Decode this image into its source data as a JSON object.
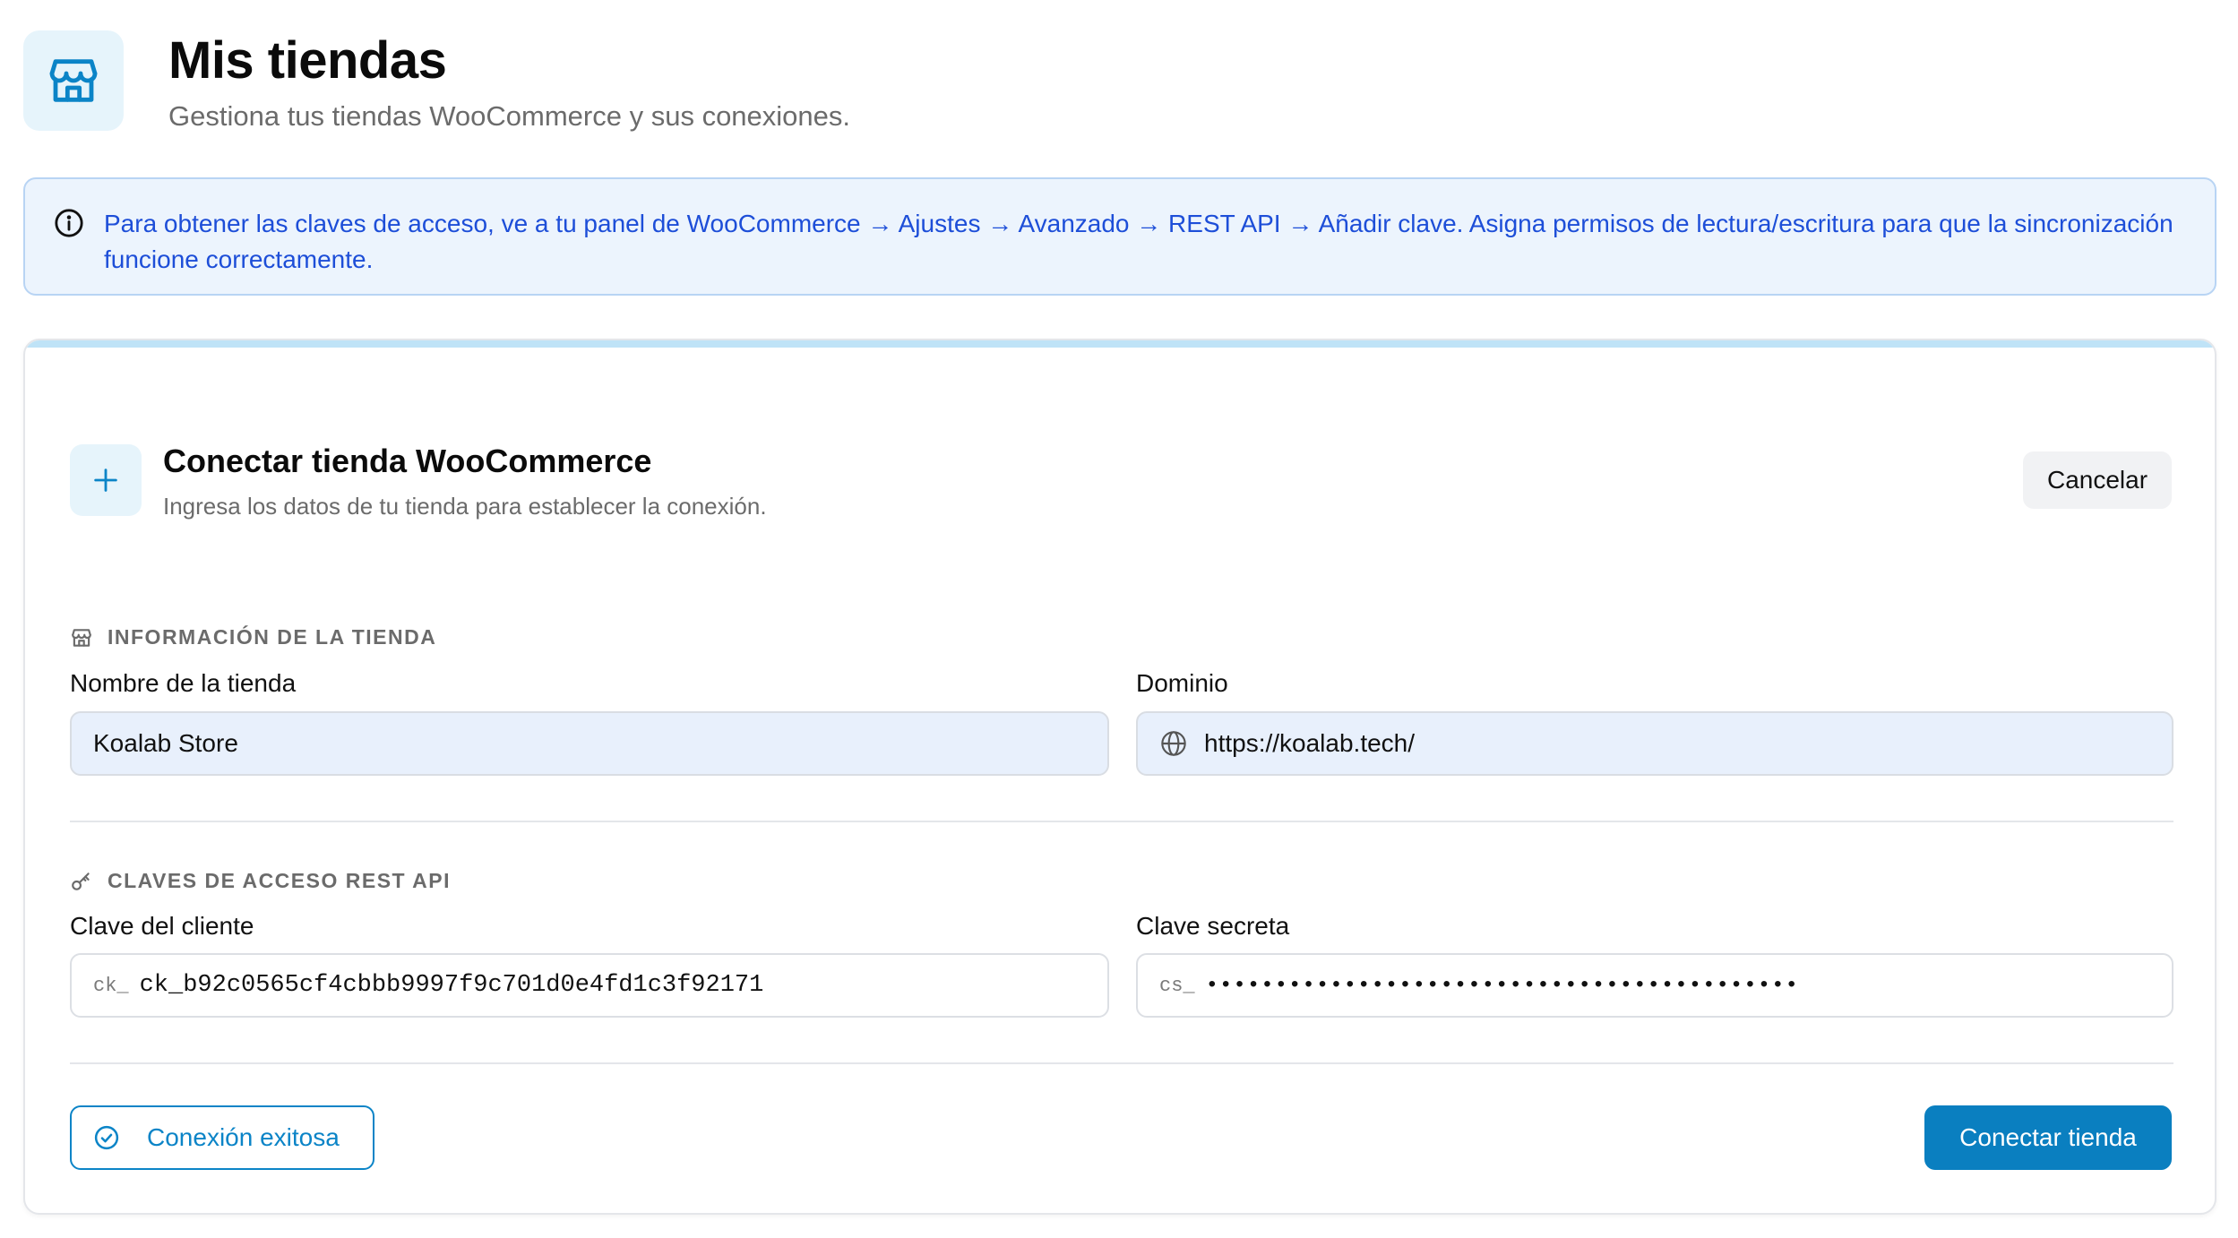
{
  "header": {
    "title": "Mis tiendas",
    "subtitle": "Gestiona tus tiendas WooCommerce y sus conexiones.",
    "icon": "store-icon"
  },
  "info_banner": {
    "icon": "info-icon",
    "text": "Para obtener las claves de acceso, ve a tu panel de WooCommerce → Ajustes → Avanzado → REST API → Añadir clave. Asigna permisos de lectura/escritura para que la sincronización funcione correctamente."
  },
  "connect_form": {
    "title": "Conectar tienda WooCommerce",
    "subtitle": "Ingresa los datos de tu tienda para establecer la conexión.",
    "cancel_label": "Cancelar",
    "store_section": {
      "label": "INFORMACIÓN DE LA TIENDA",
      "store_name_label": "Nombre de la tienda",
      "store_name_value": "Koalab Store",
      "domain_label": "Dominio",
      "domain_value": "https://koalab.tech/"
    },
    "api_section": {
      "label": "CLAVES DE ACCESO REST API",
      "client_key_label": "Clave del cliente",
      "client_key_prefix": "ck_",
      "client_key_value": "ck_b92c0565cf4cbbb9997f9c701d0e4fd1c3f92171",
      "secret_key_label": "Clave secreta",
      "secret_key_prefix": "cs_",
      "secret_key_value": "•••••••••••••••••••••••••••••••••••••••••••"
    },
    "status_label": "Conexión exitosa",
    "submit_label": "Conectar tienda"
  },
  "colors": {
    "accent": "#0a7fc0",
    "info_text": "#1d4ed8",
    "info_bg": "#ecf4fd",
    "icon_bg": "#e6f4fb"
  }
}
